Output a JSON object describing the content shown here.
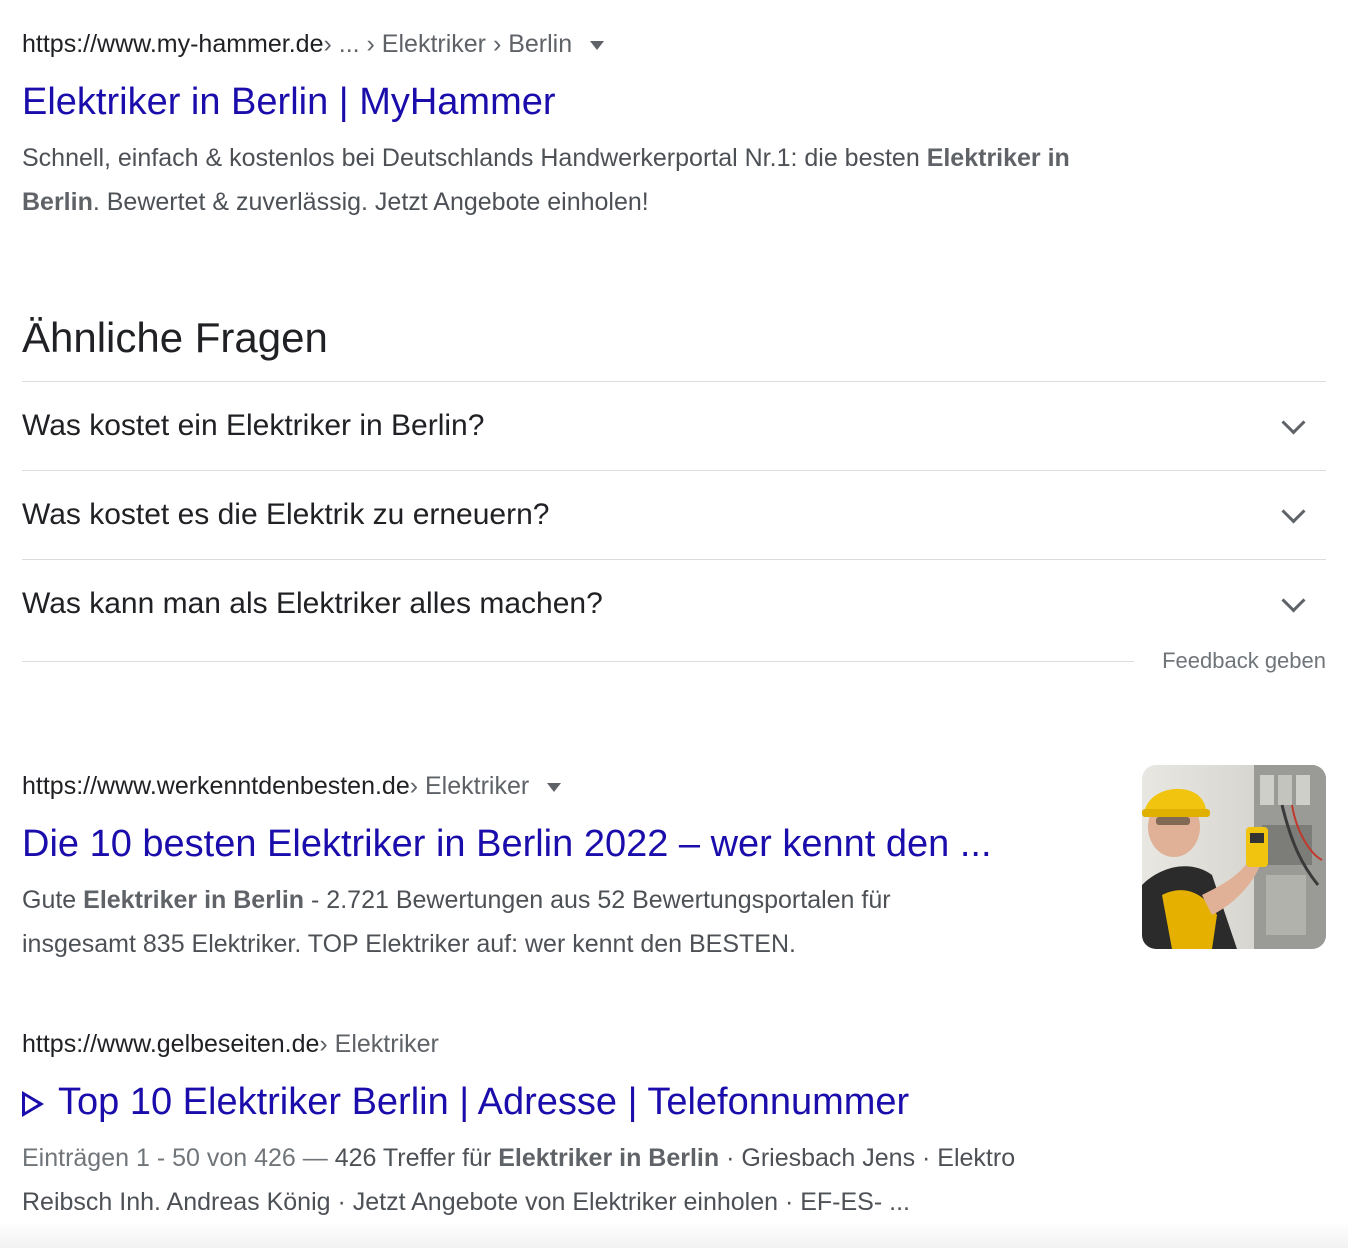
{
  "results": [
    {
      "domain": "https://www.my-hammer.de",
      "path": " › ... › Elektriker › Berlin",
      "title": "Elektriker in Berlin | MyHammer",
      "snippet_line1_a": "Schnell, einfach & kostenlos bei Deutschlands Handwerkerportal Nr.1: die besten ",
      "snippet_line1_bold": "Elektriker in",
      "snippet_line2_bold": "Berlin",
      "snippet_line2_b": ". Bewertet & zuverlässig. Jetzt Angebote einholen!"
    },
    {
      "domain": "https://www.werkenntdenbesten.de",
      "path": " › Elektriker",
      "title": "Die 10 besten Elektriker in Berlin 2022 – wer kennt den ...",
      "snippet_line1_a": "Gute ",
      "snippet_line1_bold": "Elektriker in Berlin",
      "snippet_line1_b": " - 2.721 Bewertungen aus 52 Bewertungsportalen für",
      "snippet_line2": "insgesamt 835 Elektriker. TOP Elektriker auf: wer kennt den BESTEN."
    },
    {
      "domain": "https://www.gelbeseiten.de",
      "path": " › Elektriker",
      "title": "Top 10 Elektriker Berlin | Adresse | Telefonnummer",
      "snippet_line1_dim": "Einträgen 1 - 50 von 426 — ",
      "snippet_line1_a": "426 Treffer für ",
      "snippet_line1_bold": "Elektriker in Berlin",
      "snippet_line1_b": " · Griesbach Jens · Elektro",
      "snippet_line2": "Reibsch Inh. Andreas König · Jetzt Angebote von Elektriker einholen · EF-ES- ..."
    }
  ],
  "paa": {
    "title": "Ähnliche Fragen",
    "questions": [
      "Was kostet ein Elektriker in Berlin?",
      "Was kostet es die Elektrik zu erneuern?",
      "Was kann man als Elektriker alles machen?"
    ],
    "feedback": "Feedback geben"
  },
  "colors": {
    "link": "#1a0dab",
    "text": "#202124",
    "snippet": "#4d5156",
    "muted": "#70757a",
    "divider": "#dadce0"
  }
}
